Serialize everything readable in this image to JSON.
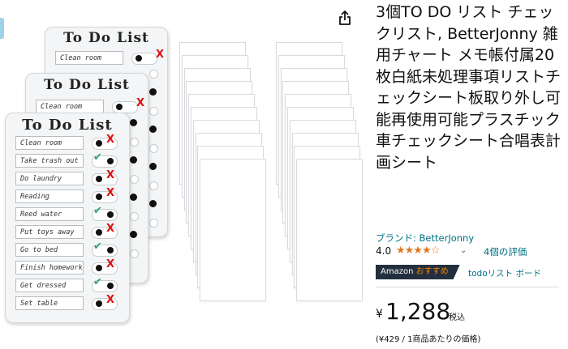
{
  "product": {
    "title": "3個TO DO リスト チェックリスト, BetterJonny 雑用チャート メモ帳付属20枚白紙未処理事項リストチェックシート板取り外し可能再使用可能プラスチック車チェックシート合唱表計画シート",
    "brand": "ブランド: BetterJonny",
    "rating": "4.0",
    "stars": "★★★★☆",
    "reviews_chevron": "⌄",
    "reviews": "4個の評価",
    "badge_prefix": "Amazon ",
    "badge_pick": "おすすめ",
    "badge_category": "todoリスト ボード",
    "price_symbol": "¥",
    "price": "1,288",
    "tax_note": "税込",
    "unit_price": "(¥429 / 1商品あたりの価格)"
  },
  "image": {
    "board_title": "To Do List",
    "tasks": [
      "Clean room",
      "Take trash out",
      "Do laundry",
      "Reading",
      "Reed water",
      "Put toys away",
      "Go to bed",
      "Finish homework",
      "Get dressed",
      "Set table"
    ],
    "task_marks": [
      "x",
      "c",
      "x",
      "x",
      "c",
      "x",
      "c",
      "x",
      "c",
      "x"
    ],
    "mark_x": "X",
    "mark_c": "✔"
  },
  "icons": {
    "share": "share-icon",
    "star": "star-icon"
  },
  "colors": {
    "link": "#007185",
    "star": "#de7921",
    "badge_bg": "#232f3e",
    "badge_pick": "#f08804",
    "x_mark": "#dd1111",
    "check_mark": "#2aa36b"
  }
}
